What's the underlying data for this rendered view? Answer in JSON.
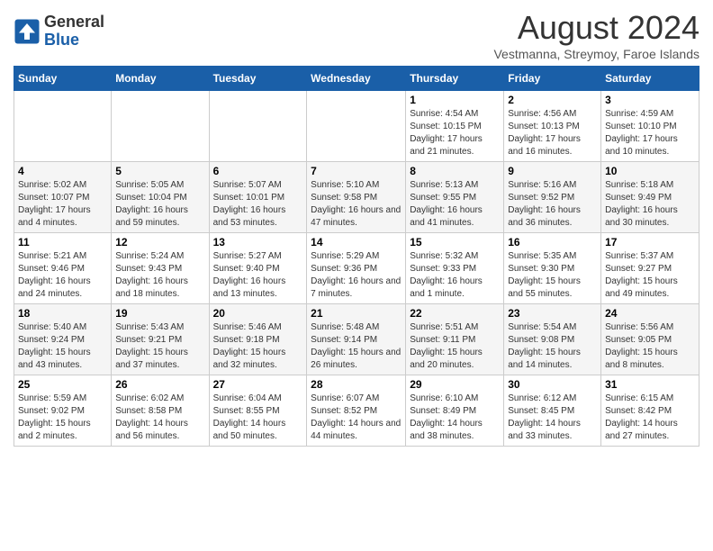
{
  "header": {
    "logo": {
      "general": "General",
      "blue": "Blue"
    },
    "title": "August 2024",
    "location": "Vestmanna, Streymoy, Faroe Islands"
  },
  "weekdays": [
    "Sunday",
    "Monday",
    "Tuesday",
    "Wednesday",
    "Thursday",
    "Friday",
    "Saturday"
  ],
  "weeks": [
    [
      {
        "day": "",
        "sunrise": "",
        "sunset": "",
        "daylight": ""
      },
      {
        "day": "",
        "sunrise": "",
        "sunset": "",
        "daylight": ""
      },
      {
        "day": "",
        "sunrise": "",
        "sunset": "",
        "daylight": ""
      },
      {
        "day": "",
        "sunrise": "",
        "sunset": "",
        "daylight": ""
      },
      {
        "day": "1",
        "sunrise": "Sunrise: 4:54 AM",
        "sunset": "Sunset: 10:15 PM",
        "daylight": "Daylight: 17 hours and 21 minutes."
      },
      {
        "day": "2",
        "sunrise": "Sunrise: 4:56 AM",
        "sunset": "Sunset: 10:13 PM",
        "daylight": "Daylight: 17 hours and 16 minutes."
      },
      {
        "day": "3",
        "sunrise": "Sunrise: 4:59 AM",
        "sunset": "Sunset: 10:10 PM",
        "daylight": "Daylight: 17 hours and 10 minutes."
      }
    ],
    [
      {
        "day": "4",
        "sunrise": "Sunrise: 5:02 AM",
        "sunset": "Sunset: 10:07 PM",
        "daylight": "Daylight: 17 hours and 4 minutes."
      },
      {
        "day": "5",
        "sunrise": "Sunrise: 5:05 AM",
        "sunset": "Sunset: 10:04 PM",
        "daylight": "Daylight: 16 hours and 59 minutes."
      },
      {
        "day": "6",
        "sunrise": "Sunrise: 5:07 AM",
        "sunset": "Sunset: 10:01 PM",
        "daylight": "Daylight: 16 hours and 53 minutes."
      },
      {
        "day": "7",
        "sunrise": "Sunrise: 5:10 AM",
        "sunset": "Sunset: 9:58 PM",
        "daylight": "Daylight: 16 hours and 47 minutes."
      },
      {
        "day": "8",
        "sunrise": "Sunrise: 5:13 AM",
        "sunset": "Sunset: 9:55 PM",
        "daylight": "Daylight: 16 hours and 41 minutes."
      },
      {
        "day": "9",
        "sunrise": "Sunrise: 5:16 AM",
        "sunset": "Sunset: 9:52 PM",
        "daylight": "Daylight: 16 hours and 36 minutes."
      },
      {
        "day": "10",
        "sunrise": "Sunrise: 5:18 AM",
        "sunset": "Sunset: 9:49 PM",
        "daylight": "Daylight: 16 hours and 30 minutes."
      }
    ],
    [
      {
        "day": "11",
        "sunrise": "Sunrise: 5:21 AM",
        "sunset": "Sunset: 9:46 PM",
        "daylight": "Daylight: 16 hours and 24 minutes."
      },
      {
        "day": "12",
        "sunrise": "Sunrise: 5:24 AM",
        "sunset": "Sunset: 9:43 PM",
        "daylight": "Daylight: 16 hours and 18 minutes."
      },
      {
        "day": "13",
        "sunrise": "Sunrise: 5:27 AM",
        "sunset": "Sunset: 9:40 PM",
        "daylight": "Daylight: 16 hours and 13 minutes."
      },
      {
        "day": "14",
        "sunrise": "Sunrise: 5:29 AM",
        "sunset": "Sunset: 9:36 PM",
        "daylight": "Daylight: 16 hours and 7 minutes."
      },
      {
        "day": "15",
        "sunrise": "Sunrise: 5:32 AM",
        "sunset": "Sunset: 9:33 PM",
        "daylight": "Daylight: 16 hours and 1 minute."
      },
      {
        "day": "16",
        "sunrise": "Sunrise: 5:35 AM",
        "sunset": "Sunset: 9:30 PM",
        "daylight": "Daylight: 15 hours and 55 minutes."
      },
      {
        "day": "17",
        "sunrise": "Sunrise: 5:37 AM",
        "sunset": "Sunset: 9:27 PM",
        "daylight": "Daylight: 15 hours and 49 minutes."
      }
    ],
    [
      {
        "day": "18",
        "sunrise": "Sunrise: 5:40 AM",
        "sunset": "Sunset: 9:24 PM",
        "daylight": "Daylight: 15 hours and 43 minutes."
      },
      {
        "day": "19",
        "sunrise": "Sunrise: 5:43 AM",
        "sunset": "Sunset: 9:21 PM",
        "daylight": "Daylight: 15 hours and 37 minutes."
      },
      {
        "day": "20",
        "sunrise": "Sunrise: 5:46 AM",
        "sunset": "Sunset: 9:18 PM",
        "daylight": "Daylight: 15 hours and 32 minutes."
      },
      {
        "day": "21",
        "sunrise": "Sunrise: 5:48 AM",
        "sunset": "Sunset: 9:14 PM",
        "daylight": "Daylight: 15 hours and 26 minutes."
      },
      {
        "day": "22",
        "sunrise": "Sunrise: 5:51 AM",
        "sunset": "Sunset: 9:11 PM",
        "daylight": "Daylight: 15 hours and 20 minutes."
      },
      {
        "day": "23",
        "sunrise": "Sunrise: 5:54 AM",
        "sunset": "Sunset: 9:08 PM",
        "daylight": "Daylight: 15 hours and 14 minutes."
      },
      {
        "day": "24",
        "sunrise": "Sunrise: 5:56 AM",
        "sunset": "Sunset: 9:05 PM",
        "daylight": "Daylight: 15 hours and 8 minutes."
      }
    ],
    [
      {
        "day": "25",
        "sunrise": "Sunrise: 5:59 AM",
        "sunset": "Sunset: 9:02 PM",
        "daylight": "Daylight: 15 hours and 2 minutes."
      },
      {
        "day": "26",
        "sunrise": "Sunrise: 6:02 AM",
        "sunset": "Sunset: 8:58 PM",
        "daylight": "Daylight: 14 hours and 56 minutes."
      },
      {
        "day": "27",
        "sunrise": "Sunrise: 6:04 AM",
        "sunset": "Sunset: 8:55 PM",
        "daylight": "Daylight: 14 hours and 50 minutes."
      },
      {
        "day": "28",
        "sunrise": "Sunrise: 6:07 AM",
        "sunset": "Sunset: 8:52 PM",
        "daylight": "Daylight: 14 hours and 44 minutes."
      },
      {
        "day": "29",
        "sunrise": "Sunrise: 6:10 AM",
        "sunset": "Sunset: 8:49 PM",
        "daylight": "Daylight: 14 hours and 38 minutes."
      },
      {
        "day": "30",
        "sunrise": "Sunrise: 6:12 AM",
        "sunset": "Sunset: 8:45 PM",
        "daylight": "Daylight: 14 hours and 33 minutes."
      },
      {
        "day": "31",
        "sunrise": "Sunrise: 6:15 AM",
        "sunset": "Sunset: 8:42 PM",
        "daylight": "Daylight: 14 hours and 27 minutes."
      }
    ]
  ]
}
